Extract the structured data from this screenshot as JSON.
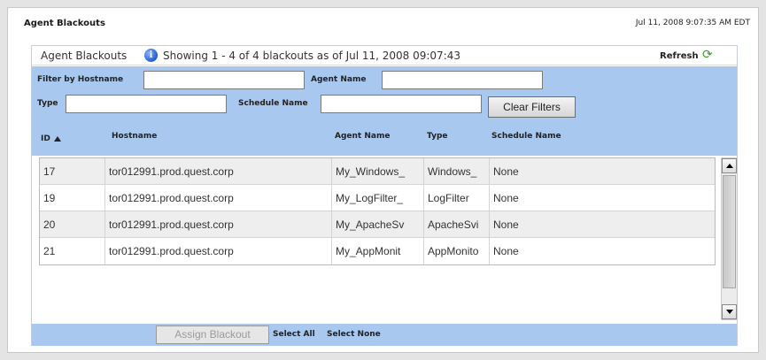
{
  "page": {
    "title": "Agent Blackouts",
    "timestamp": "Jul 11, 2008 9:07:35 AM EDT"
  },
  "panel": {
    "title": "Agent Blackouts",
    "info_icon": "info-icon",
    "showing_text": "Showing 1 - 4  of 4 blackouts as of Jul 11, 2008 09:07:43",
    "refresh_label": "Refresh",
    "refresh_icon": "refresh-icon"
  },
  "filters": {
    "hostname_label": "Filter by Hostname",
    "hostname_value": "",
    "agent_name_label": "Agent Name",
    "agent_name_value": "",
    "type_label": "Type",
    "type_value": "",
    "schedule_name_label": "Schedule Name",
    "schedule_name_value": "",
    "clear_label": "Clear Filters"
  },
  "table": {
    "columns": [
      "ID",
      "Hostname",
      "Agent Name",
      "Type",
      "Schedule Name"
    ],
    "sort_icon": "sort-ascending-icon",
    "rows": [
      {
        "id": "17",
        "hostname": "tor012991.prod.quest.corp",
        "agent": "My_Windows_",
        "type": "Windows_",
        "schedule": "None"
      },
      {
        "id": "19",
        "hostname": "tor012991.prod.quest.corp",
        "agent": "My_LogFilter_",
        "type": "LogFilter",
        "schedule": "None"
      },
      {
        "id": "20",
        "hostname": "tor012991.prod.quest.corp",
        "agent": "My_ApacheSv",
        "type": "ApacheSvi",
        "schedule": "None"
      },
      {
        "id": "21",
        "hostname": "tor012991.prod.quest.corp",
        "agent": "My_AppMonit",
        "type": "AppMonito",
        "schedule": "None"
      }
    ]
  },
  "footer": {
    "assign_label": "Assign Blackout",
    "select_all": "Select All",
    "select_none": "Select None"
  },
  "colors": {
    "filter_bg": "#a8c8f0",
    "row_alt": "#eeeeee"
  }
}
